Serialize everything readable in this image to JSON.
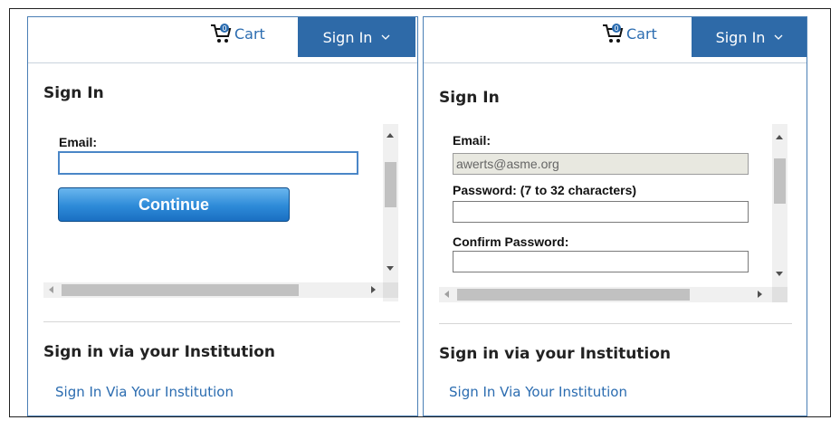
{
  "left_panel": {
    "cart_label": "Cart",
    "cart_count": "0",
    "signin_button_label": "Sign In",
    "signin_heading": "Sign In",
    "email_label": "Email:",
    "email_value": "",
    "continue_label": "Continue",
    "institution_heading": "Sign in via your Institution",
    "institution_link": "Sign In Via Your Institution"
  },
  "right_panel": {
    "cart_label": "Cart",
    "cart_count": "0",
    "signin_button_label": "Sign In",
    "signin_heading": "Sign In",
    "email_label": "Email:",
    "email_value": "awerts@asme.org",
    "password_label": "Password: (7 to 32 characters)",
    "password_value": "",
    "confirm_password_label": "Confirm Password:",
    "confirm_password_value": "",
    "institution_heading": "Sign in via your Institution",
    "institution_link": "Sign In Via Your Institution"
  },
  "colors": {
    "brand_blue": "#2e6aa8",
    "link_blue": "#2b6cb0",
    "continue_gradient_top": "#6ab6ee",
    "continue_gradient_bottom": "#1a6fc2"
  },
  "icons": [
    "cart-icon",
    "chevron-down-icon",
    "scroll-up-arrow",
    "scroll-down-arrow",
    "scroll-left-arrow",
    "scroll-right-arrow"
  ]
}
